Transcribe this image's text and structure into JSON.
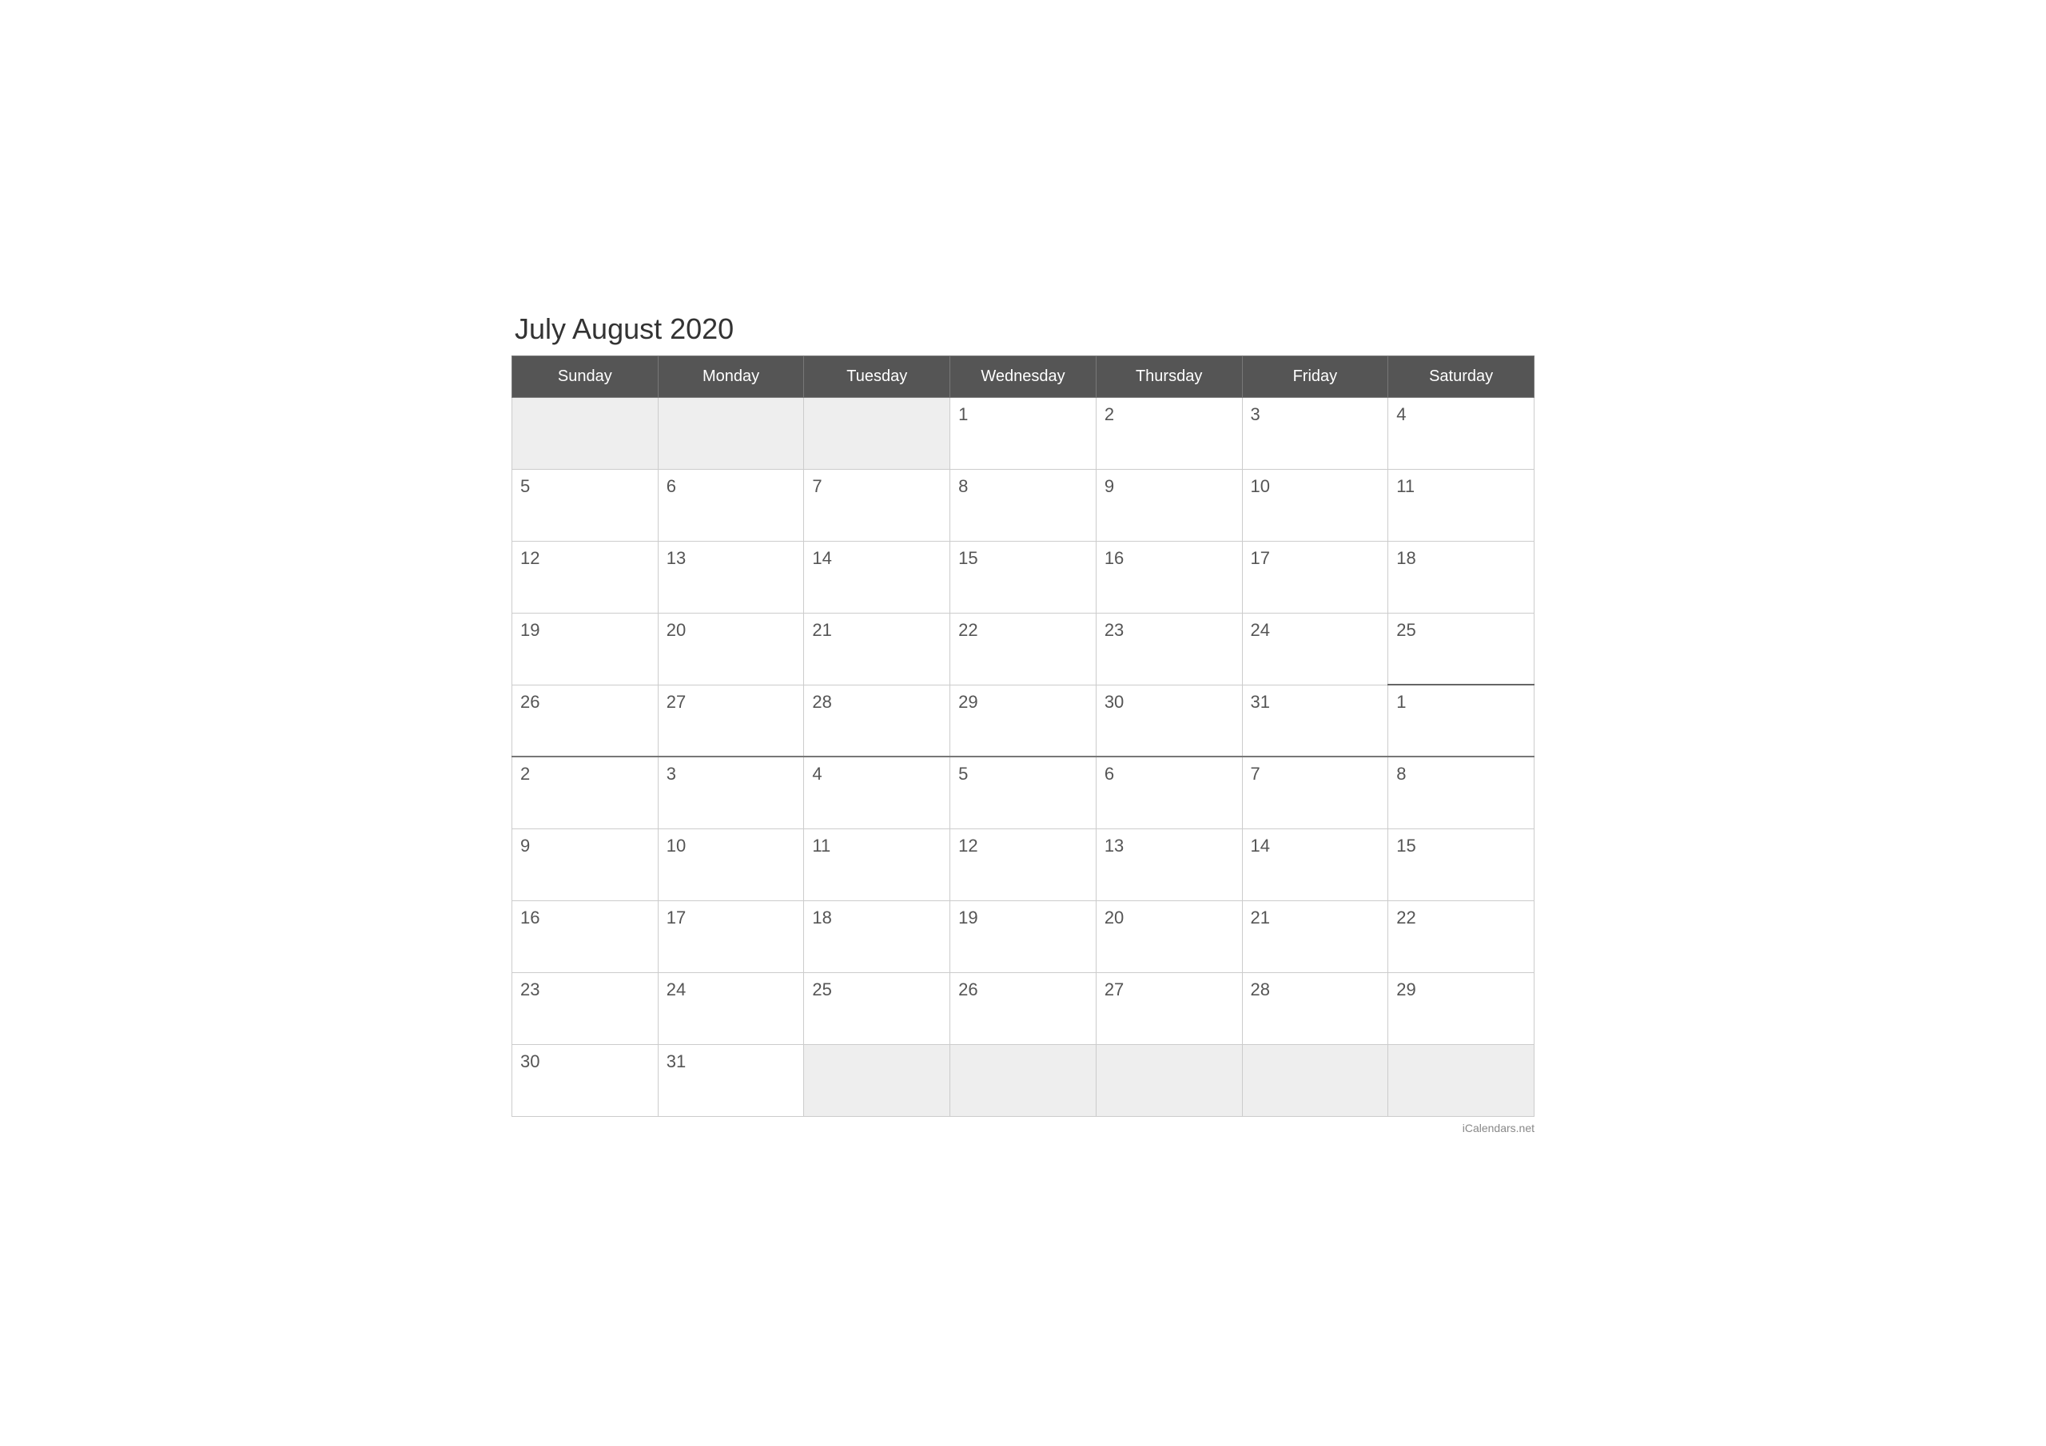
{
  "title": "July August 2020",
  "footer": "iCalendars.net",
  "headers": [
    "Sunday",
    "Monday",
    "Tuesday",
    "Wednesday",
    "Thursday",
    "Friday",
    "Saturday"
  ],
  "weeks": [
    [
      {
        "day": "",
        "empty": true
      },
      {
        "day": "",
        "empty": true
      },
      {
        "day": "",
        "empty": true
      },
      {
        "day": "1",
        "empty": false
      },
      {
        "day": "2",
        "empty": false
      },
      {
        "day": "3",
        "empty": false
      },
      {
        "day": "4",
        "empty": false
      }
    ],
    [
      {
        "day": "5",
        "empty": false
      },
      {
        "day": "6",
        "empty": false
      },
      {
        "day": "7",
        "empty": false
      },
      {
        "day": "8",
        "empty": false
      },
      {
        "day": "9",
        "empty": false
      },
      {
        "day": "10",
        "empty": false
      },
      {
        "day": "11",
        "empty": false
      }
    ],
    [
      {
        "day": "12",
        "empty": false
      },
      {
        "day": "13",
        "empty": false
      },
      {
        "day": "14",
        "empty": false
      },
      {
        "day": "15",
        "empty": false
      },
      {
        "day": "16",
        "empty": false
      },
      {
        "day": "17",
        "empty": false
      },
      {
        "day": "18",
        "empty": false
      }
    ],
    [
      {
        "day": "19",
        "empty": false
      },
      {
        "day": "20",
        "empty": false
      },
      {
        "day": "21",
        "empty": false
      },
      {
        "day": "22",
        "empty": false
      },
      {
        "day": "23",
        "empty": false
      },
      {
        "day": "24",
        "empty": false
      },
      {
        "day": "25",
        "empty": false
      }
    ],
    [
      {
        "day": "26",
        "empty": false
      },
      {
        "day": "27",
        "empty": false
      },
      {
        "day": "28",
        "empty": false
      },
      {
        "day": "29",
        "empty": false
      },
      {
        "day": "30",
        "empty": false
      },
      {
        "day": "31",
        "empty": false
      },
      {
        "day": "1",
        "empty": false,
        "next_month": true
      }
    ],
    [
      {
        "day": "2",
        "empty": false
      },
      {
        "day": "3",
        "empty": false
      },
      {
        "day": "4",
        "empty": false
      },
      {
        "day": "5",
        "empty": false
      },
      {
        "day": "6",
        "empty": false
      },
      {
        "day": "7",
        "empty": false
      },
      {
        "day": "8",
        "empty": false
      }
    ],
    [
      {
        "day": "9",
        "empty": false
      },
      {
        "day": "10",
        "empty": false
      },
      {
        "day": "11",
        "empty": false
      },
      {
        "day": "12",
        "empty": false
      },
      {
        "day": "13",
        "empty": false
      },
      {
        "day": "14",
        "empty": false
      },
      {
        "day": "15",
        "empty": false
      }
    ],
    [
      {
        "day": "16",
        "empty": false
      },
      {
        "day": "17",
        "empty": false
      },
      {
        "day": "18",
        "empty": false
      },
      {
        "day": "19",
        "empty": false
      },
      {
        "day": "20",
        "empty": false
      },
      {
        "day": "21",
        "empty": false
      },
      {
        "day": "22",
        "empty": false
      }
    ],
    [
      {
        "day": "23",
        "empty": false
      },
      {
        "day": "24",
        "empty": false
      },
      {
        "day": "25",
        "empty": false
      },
      {
        "day": "26",
        "empty": false
      },
      {
        "day": "27",
        "empty": false
      },
      {
        "day": "28",
        "empty": false
      },
      {
        "day": "29",
        "empty": false
      }
    ],
    [
      {
        "day": "30",
        "empty": false
      },
      {
        "day": "31",
        "empty": false
      },
      {
        "day": "",
        "empty": true
      },
      {
        "day": "",
        "empty": true
      },
      {
        "day": "",
        "empty": true
      },
      {
        "day": "",
        "empty": true
      },
      {
        "day": "",
        "empty": true
      }
    ]
  ]
}
